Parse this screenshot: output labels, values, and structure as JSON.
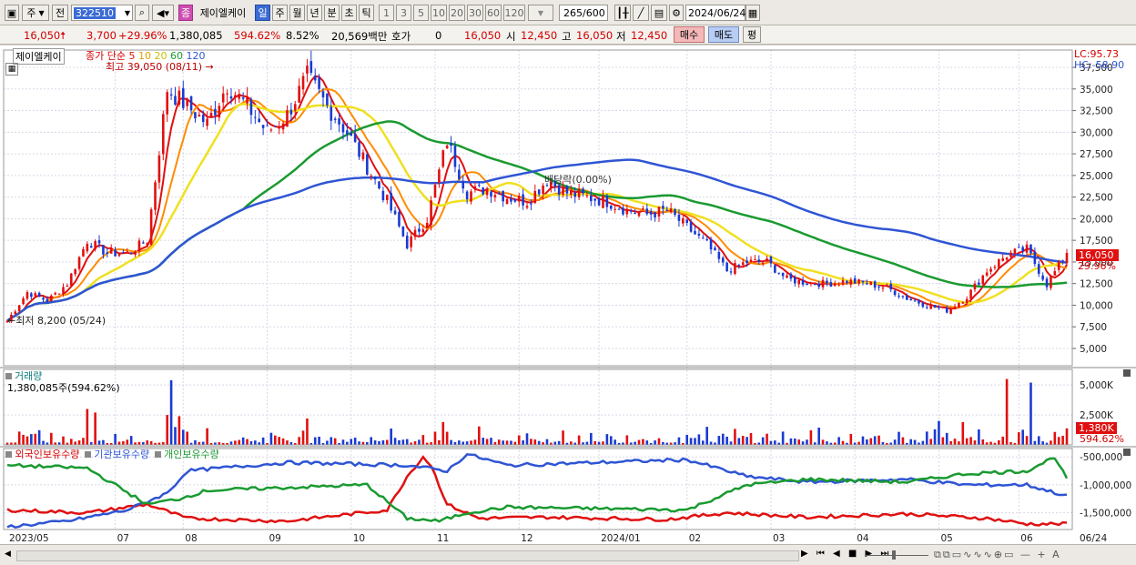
{
  "toolbar": {
    "market": "주",
    "prev_label": "전",
    "code": "322510",
    "company_badge": "종",
    "company_name": "제이엘케이",
    "periods": [
      "일",
      "주",
      "월",
      "년",
      "분",
      "초",
      "틱"
    ],
    "active_period": "일",
    "intervals": [
      "1",
      "3",
      "5",
      "10",
      "20",
      "30",
      "60",
      "120"
    ],
    "count": "265",
    "count_max": "/600",
    "date": "2024/06/24"
  },
  "quote": {
    "price": "16,050",
    "change": "3,700",
    "change_pct": "+29.96%",
    "volume": "1,380,085",
    "volume_pct": "594.62%",
    "turnover_rate": "8.52%",
    "value": "20,569백만",
    "hoga_label": "호가",
    "hoga_value": "0",
    "ask": "16,050",
    "open_label": "시",
    "open": "12,450",
    "high_label": "고",
    "high": "16,050",
    "low_label": "저",
    "low": "12,450",
    "buy_label": "매수",
    "sell_label": "매도",
    "eval_label": "평"
  },
  "chart": {
    "name_box": "제이엘케이",
    "ma_label": "종가 단순",
    "ma_periods": [
      "5",
      "10",
      "20",
      "60",
      "120"
    ],
    "ma_colors": [
      "#e01010",
      "#ff8c00",
      "#f0e020",
      "#1a9a30",
      "#2f55d4"
    ],
    "max_note": "최고 39,050 (08/11)",
    "min_note": "최저 8,200 (05/24)",
    "div_note": "배당락(0.00%)",
    "lc": "LC:95.73",
    "hc": "HC:-58.90",
    "price_badge": "16,050",
    "pct_badge": "29.96%",
    "vol_title": "거래량",
    "vol_value": "1,380,085주(594.62%)",
    "vol_badge": "1,380K",
    "vol_pct_badge": "594.62%",
    "hold_legend": [
      "외국인보유수량",
      "기관보유수량",
      "개인보유수량"
    ],
    "hold_colors": [
      "#e01010",
      "#2f55d4",
      "#1a9a30"
    ],
    "x_labels": [
      "2023/05",
      "07",
      "08",
      "09",
      "10",
      "11",
      "12",
      "2024/01",
      "02",
      "03",
      "04",
      "05",
      "06"
    ],
    "x_right": "06/24"
  },
  "chart_data": [
    {
      "type": "candlestick",
      "title": "제이엘케이",
      "y_ticks": [
        5000,
        7500,
        10000,
        12500,
        15000,
        17500,
        20000,
        22500,
        25000,
        27500,
        30000,
        32500,
        35000,
        37500
      ],
      "y_tick_labels": [
        "5,000",
        "7,500",
        "10,000",
        "12,500",
        "15,000",
        "17,500",
        "20,000",
        "22,500",
        "25,000",
        "27,500",
        "30,000",
        "32,500",
        "35,000",
        "37,500"
      ],
      "ylim": [
        3000,
        39500
      ],
      "approx_close_path": [
        [
          0,
          8200
        ],
        [
          5,
          11500
        ],
        [
          10,
          10500
        ],
        [
          15,
          12500
        ],
        [
          20,
          17500
        ],
        [
          25,
          16000
        ],
        [
          30,
          16000
        ],
        [
          35,
          17500
        ],
        [
          40,
          35000
        ],
        [
          45,
          33000
        ],
        [
          50,
          31000
        ],
        [
          55,
          35500
        ],
        [
          60,
          33000
        ],
        [
          65,
          30000
        ],
        [
          70,
          32000
        ],
        [
          75,
          36500
        ],
        [
          80,
          33000
        ],
        [
          85,
          30000
        ],
        [
          90,
          26000
        ],
        [
          95,
          22000
        ],
        [
          100,
          17000
        ],
        [
          105,
          20000
        ],
        [
          110,
          29000
        ],
        [
          115,
          23000
        ],
        [
          120,
          23500
        ],
        [
          125,
          22500
        ],
        [
          130,
          22000
        ],
        [
          135,
          24500
        ],
        [
          140,
          23000
        ],
        [
          145,
          22500
        ],
        [
          150,
          22000
        ],
        [
          155,
          21000
        ],
        [
          160,
          20500
        ],
        [
          165,
          21000
        ],
        [
          170,
          19000
        ],
        [
          175,
          17000
        ],
        [
          180,
          14000
        ],
        [
          185,
          15000
        ],
        [
          190,
          15000
        ],
        [
          195,
          13000
        ],
        [
          200,
          12600
        ],
        [
          205,
          12500
        ],
        [
          210,
          12800
        ],
        [
          215,
          12500
        ],
        [
          220,
          12000
        ],
        [
          225,
          10800
        ],
        [
          230,
          10000
        ],
        [
          235,
          9400
        ],
        [
          240,
          11000
        ],
        [
          245,
          14000
        ],
        [
          250,
          15800
        ],
        [
          255,
          16500
        ],
        [
          260,
          12400
        ],
        [
          265,
          16050
        ]
      ],
      "moving_average_periods": [
        5,
        10,
        20,
        60,
        120
      ]
    },
    {
      "type": "bar",
      "title": "거래량",
      "y_ticks": [
        2500000,
        5000000
      ],
      "y_tick_labels": [
        "2,500K",
        "5,000K"
      ],
      "last_value": 1380085
    },
    {
      "type": "line",
      "series": [
        {
          "name": "외국인보유수량"
        },
        {
          "name": "기관보유수량"
        },
        {
          "name": "개인보유수량"
        }
      ],
      "y_ticks": [
        -500000,
        -1000000,
        -1500000
      ],
      "y_tick_labels": [
        "-500,000",
        "-1,000,000",
        "-1,500,000"
      ]
    }
  ]
}
